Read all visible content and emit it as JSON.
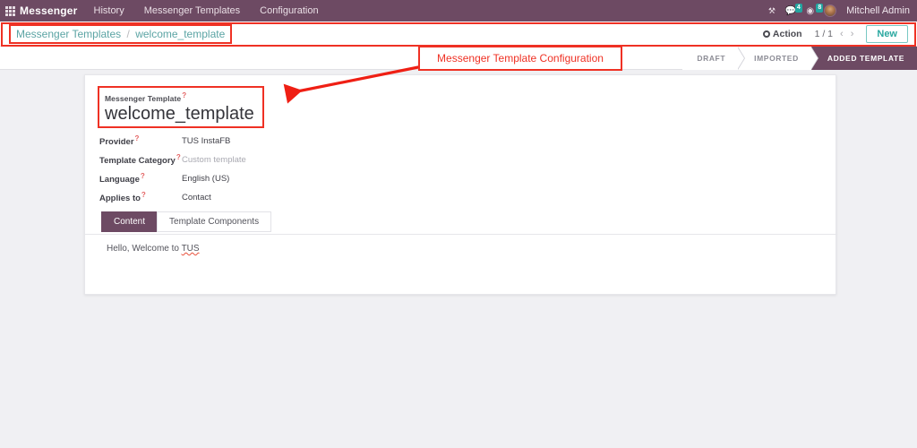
{
  "navbar": {
    "apps_icon": "grid-icon",
    "brand": "Messenger",
    "menu": [
      {
        "label": "History"
      },
      {
        "label": "Messenger Templates"
      },
      {
        "label": "Configuration"
      }
    ],
    "icons": [
      {
        "name": "bug-icon",
        "glyph": "⚒",
        "badge": ""
      },
      {
        "name": "messages-icon",
        "glyph": "💬",
        "badge": "4"
      },
      {
        "name": "activities-icon",
        "glyph": "◉",
        "badge": "8"
      }
    ],
    "user": "Mitchell Admin",
    "accent_color": "#6d4a63",
    "badge_color": "#23a5a0"
  },
  "control_panel": {
    "breadcrumb": {
      "parent": "Messenger Templates",
      "separator": "/",
      "current": "welcome_template"
    },
    "action_label": "Action",
    "pager": "1 / 1",
    "prev_arrow": "‹",
    "next_arrow": "›",
    "new_label": "New",
    "highlight_color": "#ef3124"
  },
  "status_bar": {
    "stages": [
      {
        "label": "DRAFT",
        "active": false
      },
      {
        "label": "IMPORTED",
        "active": false
      },
      {
        "label": "ADDED TEMPLATE",
        "active": true
      }
    ]
  },
  "annotation": {
    "callout_text": "Messenger Template Configuration",
    "color": "#ef3124"
  },
  "form": {
    "title_label": "Messenger Template",
    "title_required": "?",
    "title_value": "welcome_template",
    "fields": [
      {
        "label": "Provider",
        "required": "?",
        "value": "TUS InstaFB",
        "muted": false
      },
      {
        "label": "Template Category",
        "required": "?",
        "value": "Custom template",
        "muted": true
      },
      {
        "label": "Language",
        "required": "?",
        "value": "English (US)",
        "muted": false
      },
      {
        "label": "Applies to",
        "required": "?",
        "value": "Contact",
        "muted": false
      }
    ],
    "tabs": [
      {
        "label": "Content",
        "active": true
      },
      {
        "label": "Template Components",
        "active": false
      }
    ],
    "content_text_before": "Hello, Welcome to ",
    "content_text_misspelled": "TUS"
  }
}
